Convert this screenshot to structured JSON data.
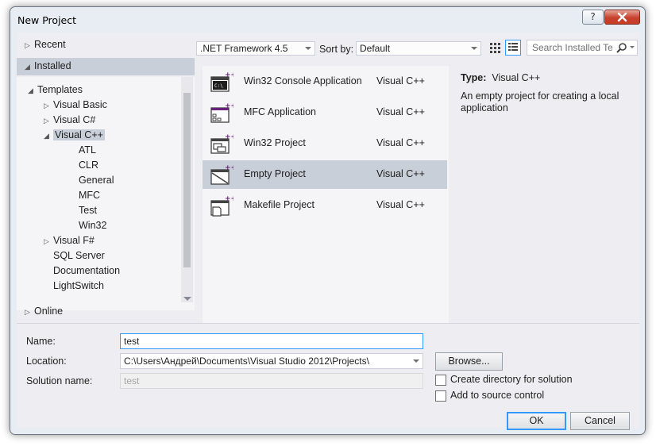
{
  "window": {
    "title": "New Project",
    "help_glyph": "?",
    "close_glyph": "x"
  },
  "tree": {
    "recent": "Recent",
    "installed": "Installed",
    "templates": "Templates",
    "items": [
      {
        "label": "Visual Basic",
        "expander": "right"
      },
      {
        "label": "Visual C#",
        "expander": "right"
      },
      {
        "label": "Visual C++",
        "expander": "down",
        "selected": true
      },
      {
        "label": "ATL"
      },
      {
        "label": "CLR"
      },
      {
        "label": "General"
      },
      {
        "label": "MFC"
      },
      {
        "label": "Test"
      },
      {
        "label": "Win32"
      },
      {
        "label": "Visual F#",
        "expander": "right"
      },
      {
        "label": "SQL Server"
      },
      {
        "label": "Documentation"
      },
      {
        "label": "LightSwitch"
      }
    ],
    "online": "Online"
  },
  "toolbar": {
    "framework": ".NET Framework 4.5",
    "sort_label": "Sort by:",
    "sort_value": "Default",
    "search_placeholder": "Search Installed Te"
  },
  "templates": [
    {
      "name": "Win32 Console Application",
      "lang": "Visual C++",
      "icon": "console-app-icon"
    },
    {
      "name": "MFC Application",
      "lang": "Visual C++",
      "icon": "mfc-app-icon"
    },
    {
      "name": "Win32 Project",
      "lang": "Visual C++",
      "icon": "win32-project-icon"
    },
    {
      "name": "Empty Project",
      "lang": "Visual C++",
      "icon": "empty-project-icon",
      "selected": true
    },
    {
      "name": "Makefile Project",
      "lang": "Visual C++",
      "icon": "makefile-project-icon"
    }
  ],
  "details": {
    "type_label": "Type:",
    "type_value": "Visual C++",
    "description": "An empty project for creating a local application"
  },
  "form": {
    "name_label": "Name:",
    "name_value": "test",
    "location_label": "Location:",
    "location_value": "C:\\Users\\Андрей\\Documents\\Visual Studio 2012\\Projects\\",
    "solution_label": "Solution name:",
    "solution_value": "test",
    "browse": "Browse...",
    "create_dir": "Create directory for solution",
    "add_source": "Add to source control",
    "ok": "OK",
    "cancel": "Cancel"
  },
  "colors": {
    "vc_purple": "#68217a",
    "selection": "#c9cfd8",
    "focus": "#3399ff"
  }
}
